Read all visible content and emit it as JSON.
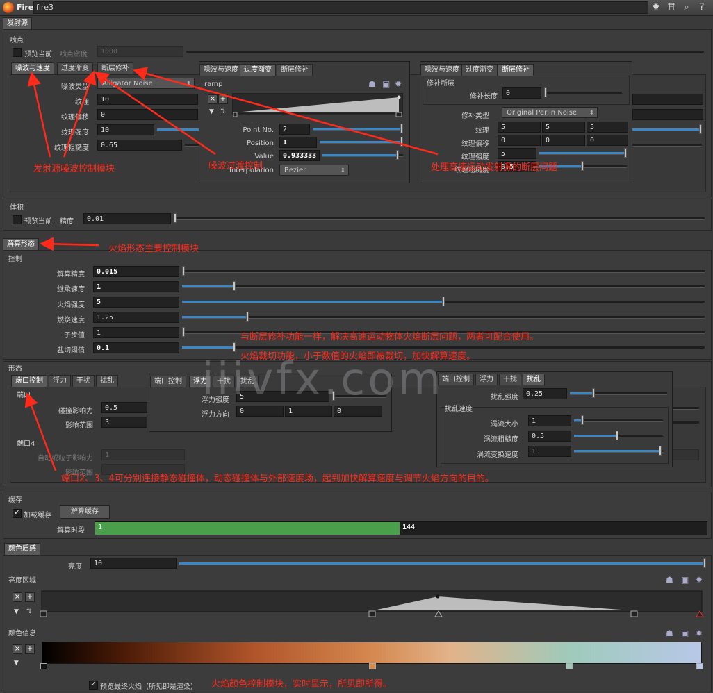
{
  "titlebar": {
    "app": "Fire",
    "node": "fire3",
    "icons": [
      "gear-icon",
      "h-icon",
      "search-icon",
      "help-icon"
    ]
  },
  "sections": {
    "emitter_tab": "发射源",
    "emit_point": "喷点",
    "preview_current": "预览当前",
    "emit_density": "喷点密度",
    "emit_density_value": "1000",
    "volume": "体积",
    "volume_preview": "预览当前",
    "volume_precision_label": "精度",
    "volume_precision": "0.01",
    "solve_tab": "解算形态",
    "control": "控制",
    "shape": "形态",
    "cache": "缓存",
    "color_tab": "颜色质感",
    "brightness_ramp": "亮度区域",
    "color_info": "颜色信息"
  },
  "noise_tabs": [
    "噪波与速度",
    "过度渐变",
    "断层修补"
  ],
  "noise": {
    "type_label": "噪波类型",
    "type_value": "Alligator Noise",
    "texture_label": "纹理",
    "texture": "10",
    "offset_label": "纹理偏移",
    "offset": "0",
    "strength_label": "纹理强度",
    "strength": "10",
    "rough_label": "纹理粗糙度",
    "rough": "0.65"
  },
  "ramp_panel": {
    "label": "ramp",
    "point_no_label": "Point No.",
    "point_no": "2",
    "position_label": "Position",
    "position": "1",
    "value_label": "Value",
    "value": "0.933333",
    "interp_label": "Interpolation",
    "interp": "Bezier"
  },
  "repair_panel": {
    "group": "修补断层",
    "length_label": "修补长度",
    "length": "0",
    "type_label": "修补类型",
    "type": "Original Perlin Noise",
    "tex_label": "纹理",
    "tex": [
      "5",
      "5",
      "5"
    ],
    "off_label": "纹理偏移",
    "off": [
      "0",
      "0",
      "0"
    ],
    "str_label": "纹理强度",
    "str": "5",
    "rough_label": "纹理粗糙度",
    "rough": "0.5"
  },
  "control": {
    "rows": [
      {
        "label": "解算精度",
        "value": "0.015",
        "bold": true,
        "pos": 0.0
      },
      {
        "label": "继承速度",
        "value": "1",
        "bold": true,
        "pos": 0.1
      },
      {
        "label": "火焰强度",
        "value": "5",
        "bold": true,
        "pos": 0.5
      },
      {
        "label": "燃烧速度",
        "value": "1.25",
        "bold": false,
        "pos": 0.125
      },
      {
        "label": "子步值",
        "value": "1",
        "bold": false,
        "pos": 0.0
      },
      {
        "label": "裁切阈值",
        "value": "0.1",
        "bold": true,
        "pos": 0.1
      }
    ]
  },
  "shape_tabs": [
    "端口控制",
    "浮力",
    "干扰",
    "扰乱"
  ],
  "shape": {
    "port": "端口",
    "collide_label": "碰撞影响力",
    "collide": "0.5",
    "range_label": "影响范围",
    "range": "3",
    "port4": "端口4",
    "port4_label": "自动或粒子影响力",
    "port4_value": "1",
    "port4_range_label": "影响范围",
    "buoy_strength_label": "浮力强度",
    "buoy_strength": "5",
    "buoy_dir_label": "浮力方向",
    "buoy_dir": [
      "0",
      "1",
      "0"
    ],
    "dist_strength_label": "扰乱强度",
    "dist_strength": "0.25",
    "dist_speed": "扰乱速度",
    "vortex_size_label": "涡流大小",
    "vortex_size": "1",
    "vortex_rough_label": "涡流粗糙度",
    "vortex_rough": "0.5",
    "vortex_change_label": "涡流变换速度",
    "vortex_change": "1"
  },
  "cache": {
    "load_label": "加载缓存",
    "solve_button": "解算缓存",
    "time_label": "解算时段",
    "start": "1",
    "end": "144"
  },
  "color": {
    "brightness_label": "亮度",
    "brightness": "10",
    "preview_final": "预览最终火焰（所见即是渲染）"
  },
  "annotations": {
    "a1": "发射源噪波控制模块",
    "a2": "噪波过渡控制",
    "a3": "处理高速运动发射源的断层问题",
    "a4": "火焰形态主要控制模块",
    "a5": "与断层修补功能一样，解决高速运动物体火焰断层问题，两者可配合使用。",
    "a6": "火焰裁切功能，小于数值的火焰即被裁切，加快解算速度。",
    "a7": "端口2、3、4可分别连接静态碰撞体，动态碰撞体与外部速度场，起到加快解算速度与调节火焰方向的目的。",
    "a8": "火焰颜色控制模块，实时显示，所见即所得。"
  },
  "watermark": "iiivfx.com",
  "colors": {
    "accent": "#3d86c6",
    "progress": "#4aa04a",
    "annotation": "#ff2a1a"
  }
}
